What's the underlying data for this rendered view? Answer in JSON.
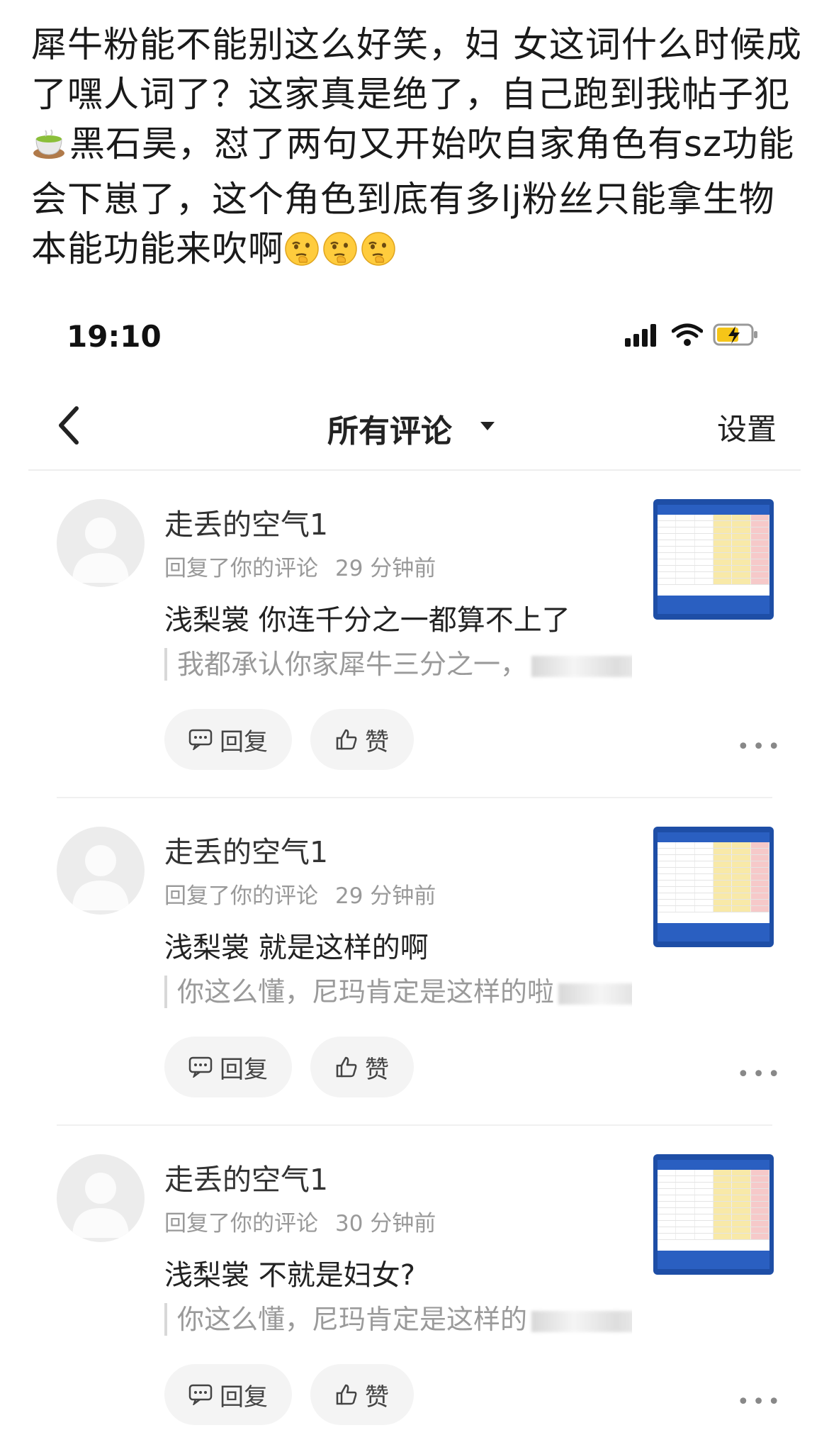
{
  "post": {
    "text_before_emoji": "犀牛粉能不能别这么好笑，妇 女这词什么时候成了嘿人词了？这家真是绝了，自己跑到我帖子犯",
    "emoji_inline": "matcha-tea-icon",
    "text_after_emoji": "黑石昊，怼了两句又开始吹自家角色有sz功能会下崽了，这个角色到底有多lj粉丝只能拿生物本能功能来吹啊",
    "trailing_emojis": [
      "thinking-face-icon",
      "thinking-face-icon",
      "thinking-face-icon"
    ]
  },
  "status_bar": {
    "time": "19:10"
  },
  "nav": {
    "title": "所有评论",
    "settings": "设置"
  },
  "comments": [
    {
      "username": "走丢的空气1",
      "meta": "回复了你的评论",
      "time": "29 分钟前",
      "reply": "浅梨裳 你连千分之一都算不上了",
      "quote": "我都承认你家犀牛三分之一，",
      "reply_label": "回复",
      "like_label": "赞"
    },
    {
      "username": "走丢的空气1",
      "meta": "回复了你的评论",
      "time": "29 分钟前",
      "reply": "浅梨裳 就是这样的啊",
      "quote": "你这么懂，尼玛肯定是这样的啦",
      "reply_label": "回复",
      "like_label": "赞"
    },
    {
      "username": "走丢的空气1",
      "meta": "回复了你的评论",
      "time": "30 分钟前",
      "reply": "浅梨裳 不就是妇女?",
      "quote": "你这么懂，尼玛肯定是这样的",
      "reply_label": "回复",
      "like_label": "赞"
    }
  ],
  "colors": {
    "accent_blue": "#1e4ea6",
    "meta_gray": "#999999",
    "pill_bg": "#f4f4f4"
  }
}
